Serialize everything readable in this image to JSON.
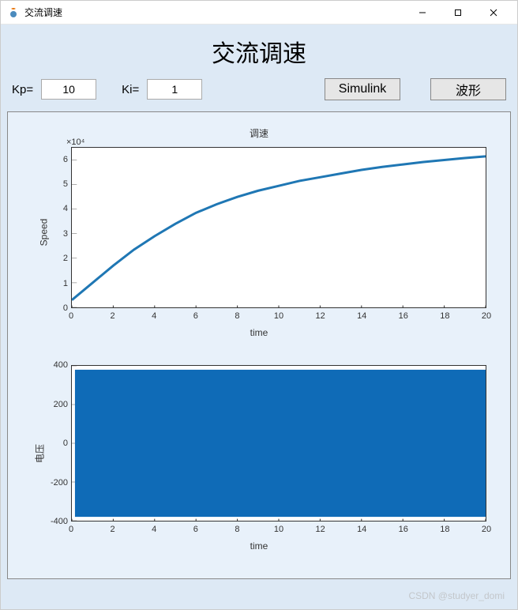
{
  "window": {
    "title": "交流调速"
  },
  "heading": "交流调速",
  "controls": {
    "kp_label": "Kp=",
    "kp_value": "10",
    "ki_label": "Ki=",
    "ki_value": "1",
    "simulink_label": "Simulink",
    "waveform_label": "波形"
  },
  "watermark": "CSDN @studyer_domi",
  "chart_data": [
    {
      "type": "line",
      "title": "调速",
      "xlabel": "time",
      "ylabel": "Speed",
      "y_exponent": "×10⁴",
      "xlim": [
        0,
        20
      ],
      "ylim": [
        0,
        6.5
      ],
      "xticks": [
        0,
        2,
        4,
        6,
        8,
        10,
        12,
        14,
        16,
        18,
        20
      ],
      "yticks": [
        0,
        1,
        2,
        3,
        4,
        5,
        6
      ],
      "series": [
        {
          "name": "speed",
          "x": [
            0,
            1,
            2,
            3,
            4,
            5,
            6,
            7,
            8,
            9,
            10,
            11,
            12,
            13,
            14,
            15,
            16,
            17,
            18,
            19,
            20
          ],
          "y": [
            0.3,
            1.0,
            1.7,
            2.35,
            2.9,
            3.4,
            3.85,
            4.2,
            4.5,
            4.75,
            4.95,
            5.15,
            5.3,
            5.45,
            5.6,
            5.72,
            5.82,
            5.92,
            6.0,
            6.08,
            6.15
          ]
        }
      ]
    },
    {
      "type": "area",
      "title": "",
      "xlabel": "time",
      "ylabel": "电压",
      "xlim": [
        0,
        20
      ],
      "ylim": [
        -400,
        400
      ],
      "xticks": [
        0,
        2,
        4,
        6,
        8,
        10,
        12,
        14,
        16,
        18,
        20
      ],
      "yticks": [
        -400,
        -200,
        0,
        200,
        400
      ],
      "series": [
        {
          "name": "voltage",
          "fill_ylow": -380,
          "fill_yhigh": 380,
          "color": "#0f6bb7"
        }
      ]
    }
  ]
}
